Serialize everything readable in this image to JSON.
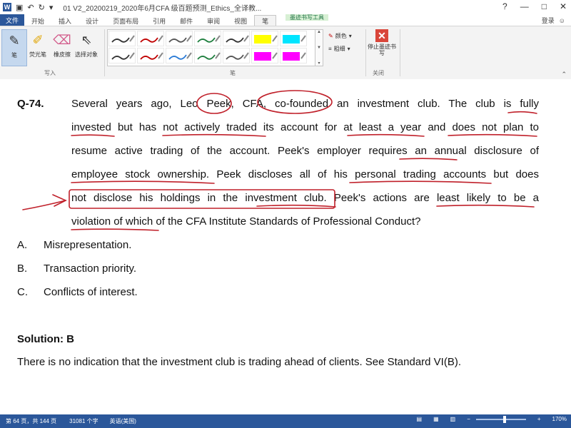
{
  "titlebar": {
    "app_icon": "W",
    "doc_title": "01 V2_20200219_2020年6月CFA 级百题预测_Ethics_全译教...",
    "context_title": "墨迹书写工具",
    "help": "?",
    "minimize": "—",
    "restore": "□",
    "close": "✕"
  },
  "tabs": [
    {
      "label": "文件"
    },
    {
      "label": "开始"
    },
    {
      "label": "插入"
    },
    {
      "label": "设计"
    },
    {
      "label": "页面布局"
    },
    {
      "label": "引用"
    },
    {
      "label": "邮件"
    },
    {
      "label": "审阅"
    },
    {
      "label": "视图"
    },
    {
      "label": "笔"
    }
  ],
  "user": {
    "name": "登录"
  },
  "ribbon": {
    "tools": [
      {
        "label": "笔",
        "icon": "✎"
      },
      {
        "label": "荧光笔",
        "icon": "✐"
      },
      {
        "label": "橡皮擦",
        "icon": "⌫"
      },
      {
        "label": "选择对象",
        "icon": "⇖"
      }
    ],
    "group_write": "写入",
    "group_pens": "笔",
    "color_label": "颜色",
    "thickness_label": "粗细",
    "stop_label": "停止墨迹书写",
    "group_close": "关闭",
    "pen_colors": [
      "#333333",
      "#c00000",
      "#555555",
      "#1f7f3f",
      "#333333",
      "#ffff00",
      "#00e5ff",
      "#333333",
      "#c00000",
      "#2b7bd6",
      "#1f7f3f",
      "#555555",
      "#ff00ff",
      "#ff00ff"
    ]
  },
  "question": {
    "number": "Q-74.",
    "lines": [
      "Several years ago, Leo Peek, CFA, co-founded an investment club. The club is fully",
      "invested but has not actively traded its account for at least a year and does not plan to",
      "resume active trading of the account. Peek's employer requires an annual disclosure of",
      "employee stock ownership. Peek discloses all of his personal trading accounts but does",
      "not disclose his holdings in the investment club. Peek's actions are least likely to be a",
      "violation of which of the CFA Institute Standards of Professional Conduct?"
    ],
    "options": [
      {
        "letter": "A.",
        "text": "Misrepresentation."
      },
      {
        "letter": "B.",
        "text": "Transaction priority."
      },
      {
        "letter": "C.",
        "text": "Conflicts of interest."
      }
    ]
  },
  "solution": {
    "title": "Solution: B",
    "explanation": "There is no indication that the investment club is trading ahead of clients. See Standard VI(B)."
  },
  "status": {
    "page": "第 64 页，共 144 页",
    "words": "31081 个字",
    "language": "英语(美国)",
    "zoom": "170%"
  },
  "colors": {
    "accent": "#2b579a",
    "ink": "#c0202a"
  }
}
